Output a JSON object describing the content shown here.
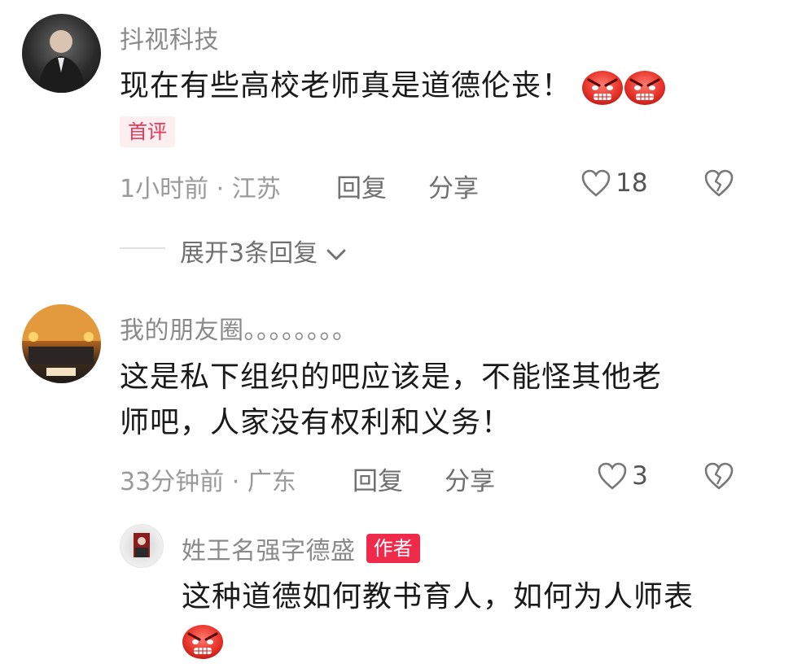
{
  "comments": [
    {
      "username": "抖视科技",
      "content": "现在有些高校老师真是道德伦丧！",
      "tag": "首评",
      "meta": "1小时前 · 江苏",
      "reply_label": "回复",
      "share_label": "分享",
      "likes": "18",
      "expand_label": "展开3条回复"
    },
    {
      "username": "我的朋友圈。。。。。。。。",
      "content_line1": "这是私下组织的吧应该是，不能怪其他老",
      "content_line2": "师吧，人家没有权利和义务！",
      "meta": "33分钟前 · 广东",
      "reply_label": "回复",
      "share_label": "分享",
      "likes": "3"
    }
  ],
  "reply": {
    "username": "姓王名强字德盛",
    "author_tag": "作者",
    "content": "这种道德如何教书育人，如何为人师表"
  },
  "icons": {
    "like": "heart-outline-icon",
    "dislike": "broken-heart-icon",
    "expand": "chevron-down-icon",
    "emoji": "angry-face-emoji"
  },
  "colors": {
    "accent": "#f02a4a",
    "first_tag_bg": "#fdeef0",
    "username": "#8a8a8a"
  }
}
